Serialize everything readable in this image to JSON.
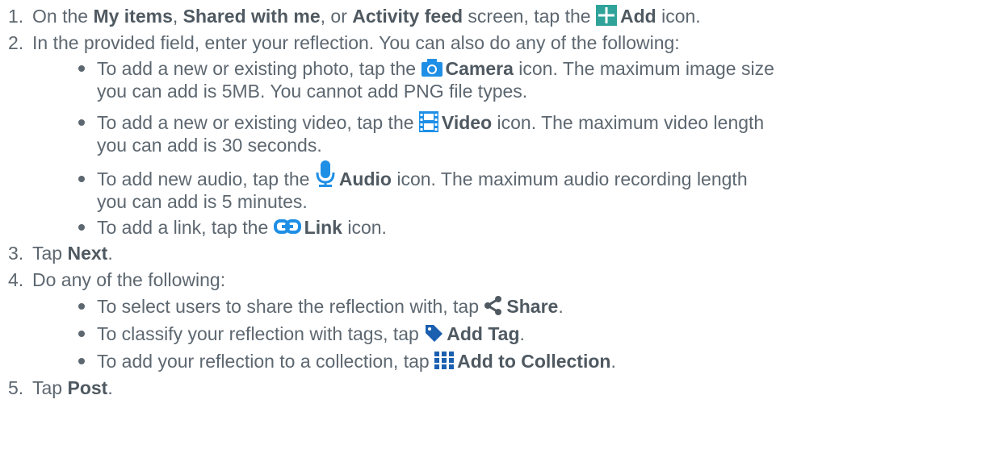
{
  "steps": {
    "s1": {
      "number": "1.",
      "pre": "On the ",
      "b1": "My items",
      "sep1": ", ",
      "b2": "Shared with me",
      "sep2": ", or ",
      "b3": "Activity feed",
      "mid": " screen, tap the ",
      "b4": "Add",
      "post": " icon.",
      "icon": "plus-icon"
    },
    "s2": {
      "number": "2.",
      "text": "In the provided field, enter your reflection. You can also do any of the following:",
      "bullets": [
        {
          "pre": "To add a new or existing photo, tap the ",
          "bold": "Camera",
          "post": " icon. The maximum image size",
          "cont": "you can add is 5MB. You cannot add PNG file types.",
          "icon": "camera-icon"
        },
        {
          "pre": "To add a new or existing video, tap the ",
          "bold": "Video",
          "post": " icon. The maximum video length",
          "cont": "you can add is 30 seconds.",
          "icon": "video-icon"
        },
        {
          "pre": "To add new audio, tap the ",
          "bold": "Audio",
          "post": " icon. The maximum audio recording length",
          "cont": "you can add is 5 minutes.",
          "icon": "microphone-icon"
        },
        {
          "pre": "To add a link, tap the ",
          "bold": "Link",
          "post": " icon.",
          "icon": "link-icon"
        }
      ]
    },
    "s3": {
      "number": "3.",
      "pre": "Tap ",
      "bold": "Next",
      "post": "."
    },
    "s4": {
      "number": "4.",
      "text": "Do any of the following:",
      "bullets": [
        {
          "pre": "To select users to share the reflection with, tap ",
          "bold": "Share",
          "post": ".",
          "icon": "share-icon"
        },
        {
          "pre": "To classify your reflection with tags, tap ",
          "bold": "Add Tag",
          "post": ".",
          "icon": "tag-icon"
        },
        {
          "pre": "To add your reflection to a collection, tap ",
          "bold": "Add to Collection",
          "post": ".",
          "icon": "grid-icon"
        }
      ]
    },
    "s5": {
      "number": "5.",
      "pre": "Tap ",
      "bold": "Post",
      "post": "."
    }
  },
  "colors": {
    "text": "#5d6770",
    "icon_teal": "#2fa39a",
    "icon_blue": "#1f8fe6",
    "icon_dark_blue": "#1a5fb0",
    "icon_gray": "#4f5961"
  }
}
